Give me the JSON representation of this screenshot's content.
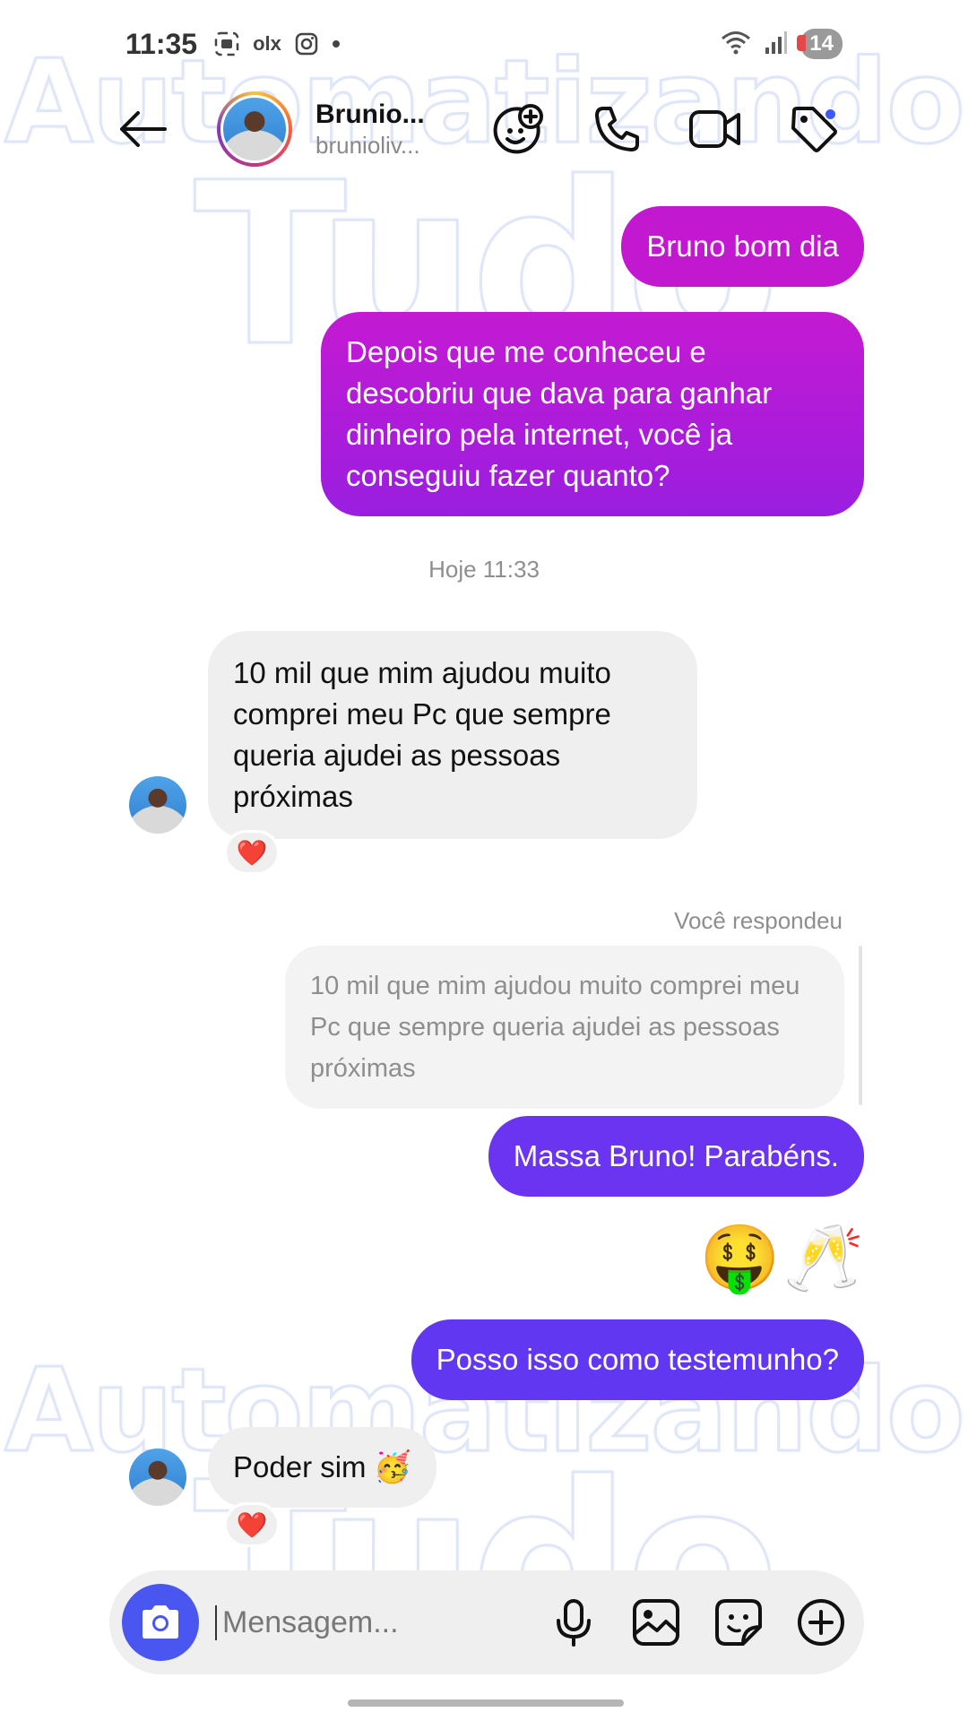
{
  "status_bar": {
    "time": "11:35",
    "olx": "olx",
    "battery": "14"
  },
  "header": {
    "name": "Brunio...",
    "username": "brunioliv..."
  },
  "messages": {
    "m1": "Bruno bom dia",
    "m2": "Depois que me conheceu e descobriu que dava para ganhar dinheiro pela internet, você ja conseguiu fazer quanto?",
    "timestamp": "Hoje 11:33",
    "m3": "10 mil que mim ajudou muito comprei meu Pc que sempre queria ajudei as pessoas próximas",
    "m3_reaction": "❤️",
    "reply_label": "Você respondeu",
    "quoted": "10 mil que mim ajudou muito comprei meu Pc que sempre queria ajudei as pessoas próximas",
    "m4": "Massa Bruno! Parabéns.",
    "emoji_1": "🤑",
    "emoji_2": "🥂",
    "m5": "Posso isso como testemunho?",
    "m6": "Poder sim",
    "m6_emoji": "🥳",
    "m6_reaction": "❤️"
  },
  "composer": {
    "placeholder": "Mensagem..."
  },
  "watermark": {
    "line1": "Automatizando",
    "line2": "Tudo"
  },
  "colors": {
    "outgoing_magenta": "#c218cf",
    "outgoing_purple": "#6a34f0",
    "incoming": "#efefef",
    "camera_button": "#4a56f0"
  }
}
